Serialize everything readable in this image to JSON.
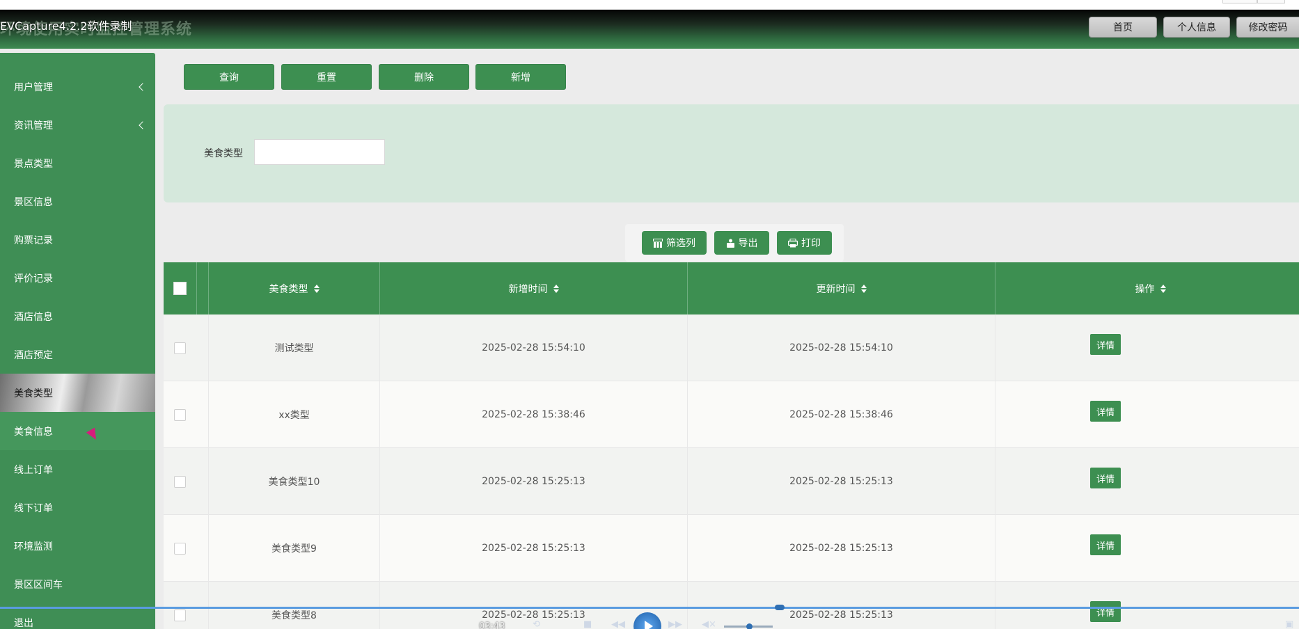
{
  "window": {
    "app_title": "环境使用实时监控管理系统",
    "capture_title": "EVCapture4.2.2软件录制"
  },
  "header": {
    "buttons": [
      "首页",
      "个人信息",
      "修改密码"
    ]
  },
  "sidebar": {
    "items": [
      {
        "label": "用户管理",
        "expandable": true
      },
      {
        "label": "资讯管理",
        "expandable": true
      },
      {
        "label": "景点类型",
        "expandable": false
      },
      {
        "label": "景区信息",
        "expandable": false
      },
      {
        "label": "购票记录",
        "expandable": false
      },
      {
        "label": "评价记录",
        "expandable": false
      },
      {
        "label": "酒店信息",
        "expandable": false
      },
      {
        "label": "酒店预定",
        "expandable": false
      },
      {
        "label": "美食类型",
        "expandable": false
      },
      {
        "label": "美食信息",
        "expandable": false
      },
      {
        "label": "线上订单",
        "expandable": false
      },
      {
        "label": "线下订单",
        "expandable": false
      },
      {
        "label": "环境监测",
        "expandable": false
      },
      {
        "label": "景区区间车",
        "expandable": false
      },
      {
        "label": "退出",
        "expandable": false
      }
    ],
    "active_index": 8,
    "hover_index": 9
  },
  "toolbar": {
    "query": "查询",
    "reset": "重置",
    "delete": "删除",
    "add": "新增"
  },
  "search": {
    "label": "美食类型",
    "value": ""
  },
  "actions": {
    "filter_columns": "筛选列",
    "export": "导出",
    "print": "打印"
  },
  "table": {
    "columns": [
      "美食类型",
      "新增时间",
      "更新时间",
      "操作"
    ],
    "rows": [
      {
        "type": "测试类型",
        "created": "2025-02-28 15:54:10",
        "updated": "2025-02-28 15:54:10",
        "action": "详情"
      },
      {
        "type": "xx类型",
        "created": "2025-02-28 15:38:46",
        "updated": "2025-02-28 15:38:46",
        "action": "详情"
      },
      {
        "type": "美食类型10",
        "created": "2025-02-28 15:25:13",
        "updated": "2025-02-28 15:25:13",
        "action": "详情"
      },
      {
        "type": "美食类型9",
        "created": "2025-02-28 15:25:13",
        "updated": "2025-02-28 15:25:13",
        "action": "详情"
      },
      {
        "type": "美食类型8",
        "created": "2025-02-28 15:25:13",
        "updated": "2025-02-28 15:25:13",
        "action": "详情"
      }
    ]
  },
  "player": {
    "time": "03:43",
    "progress": 0.6
  },
  "colors": {
    "primary_green": "#3d8f51",
    "sidebar_green": "#3f8e55",
    "panel_green": "#d5e8dc"
  }
}
